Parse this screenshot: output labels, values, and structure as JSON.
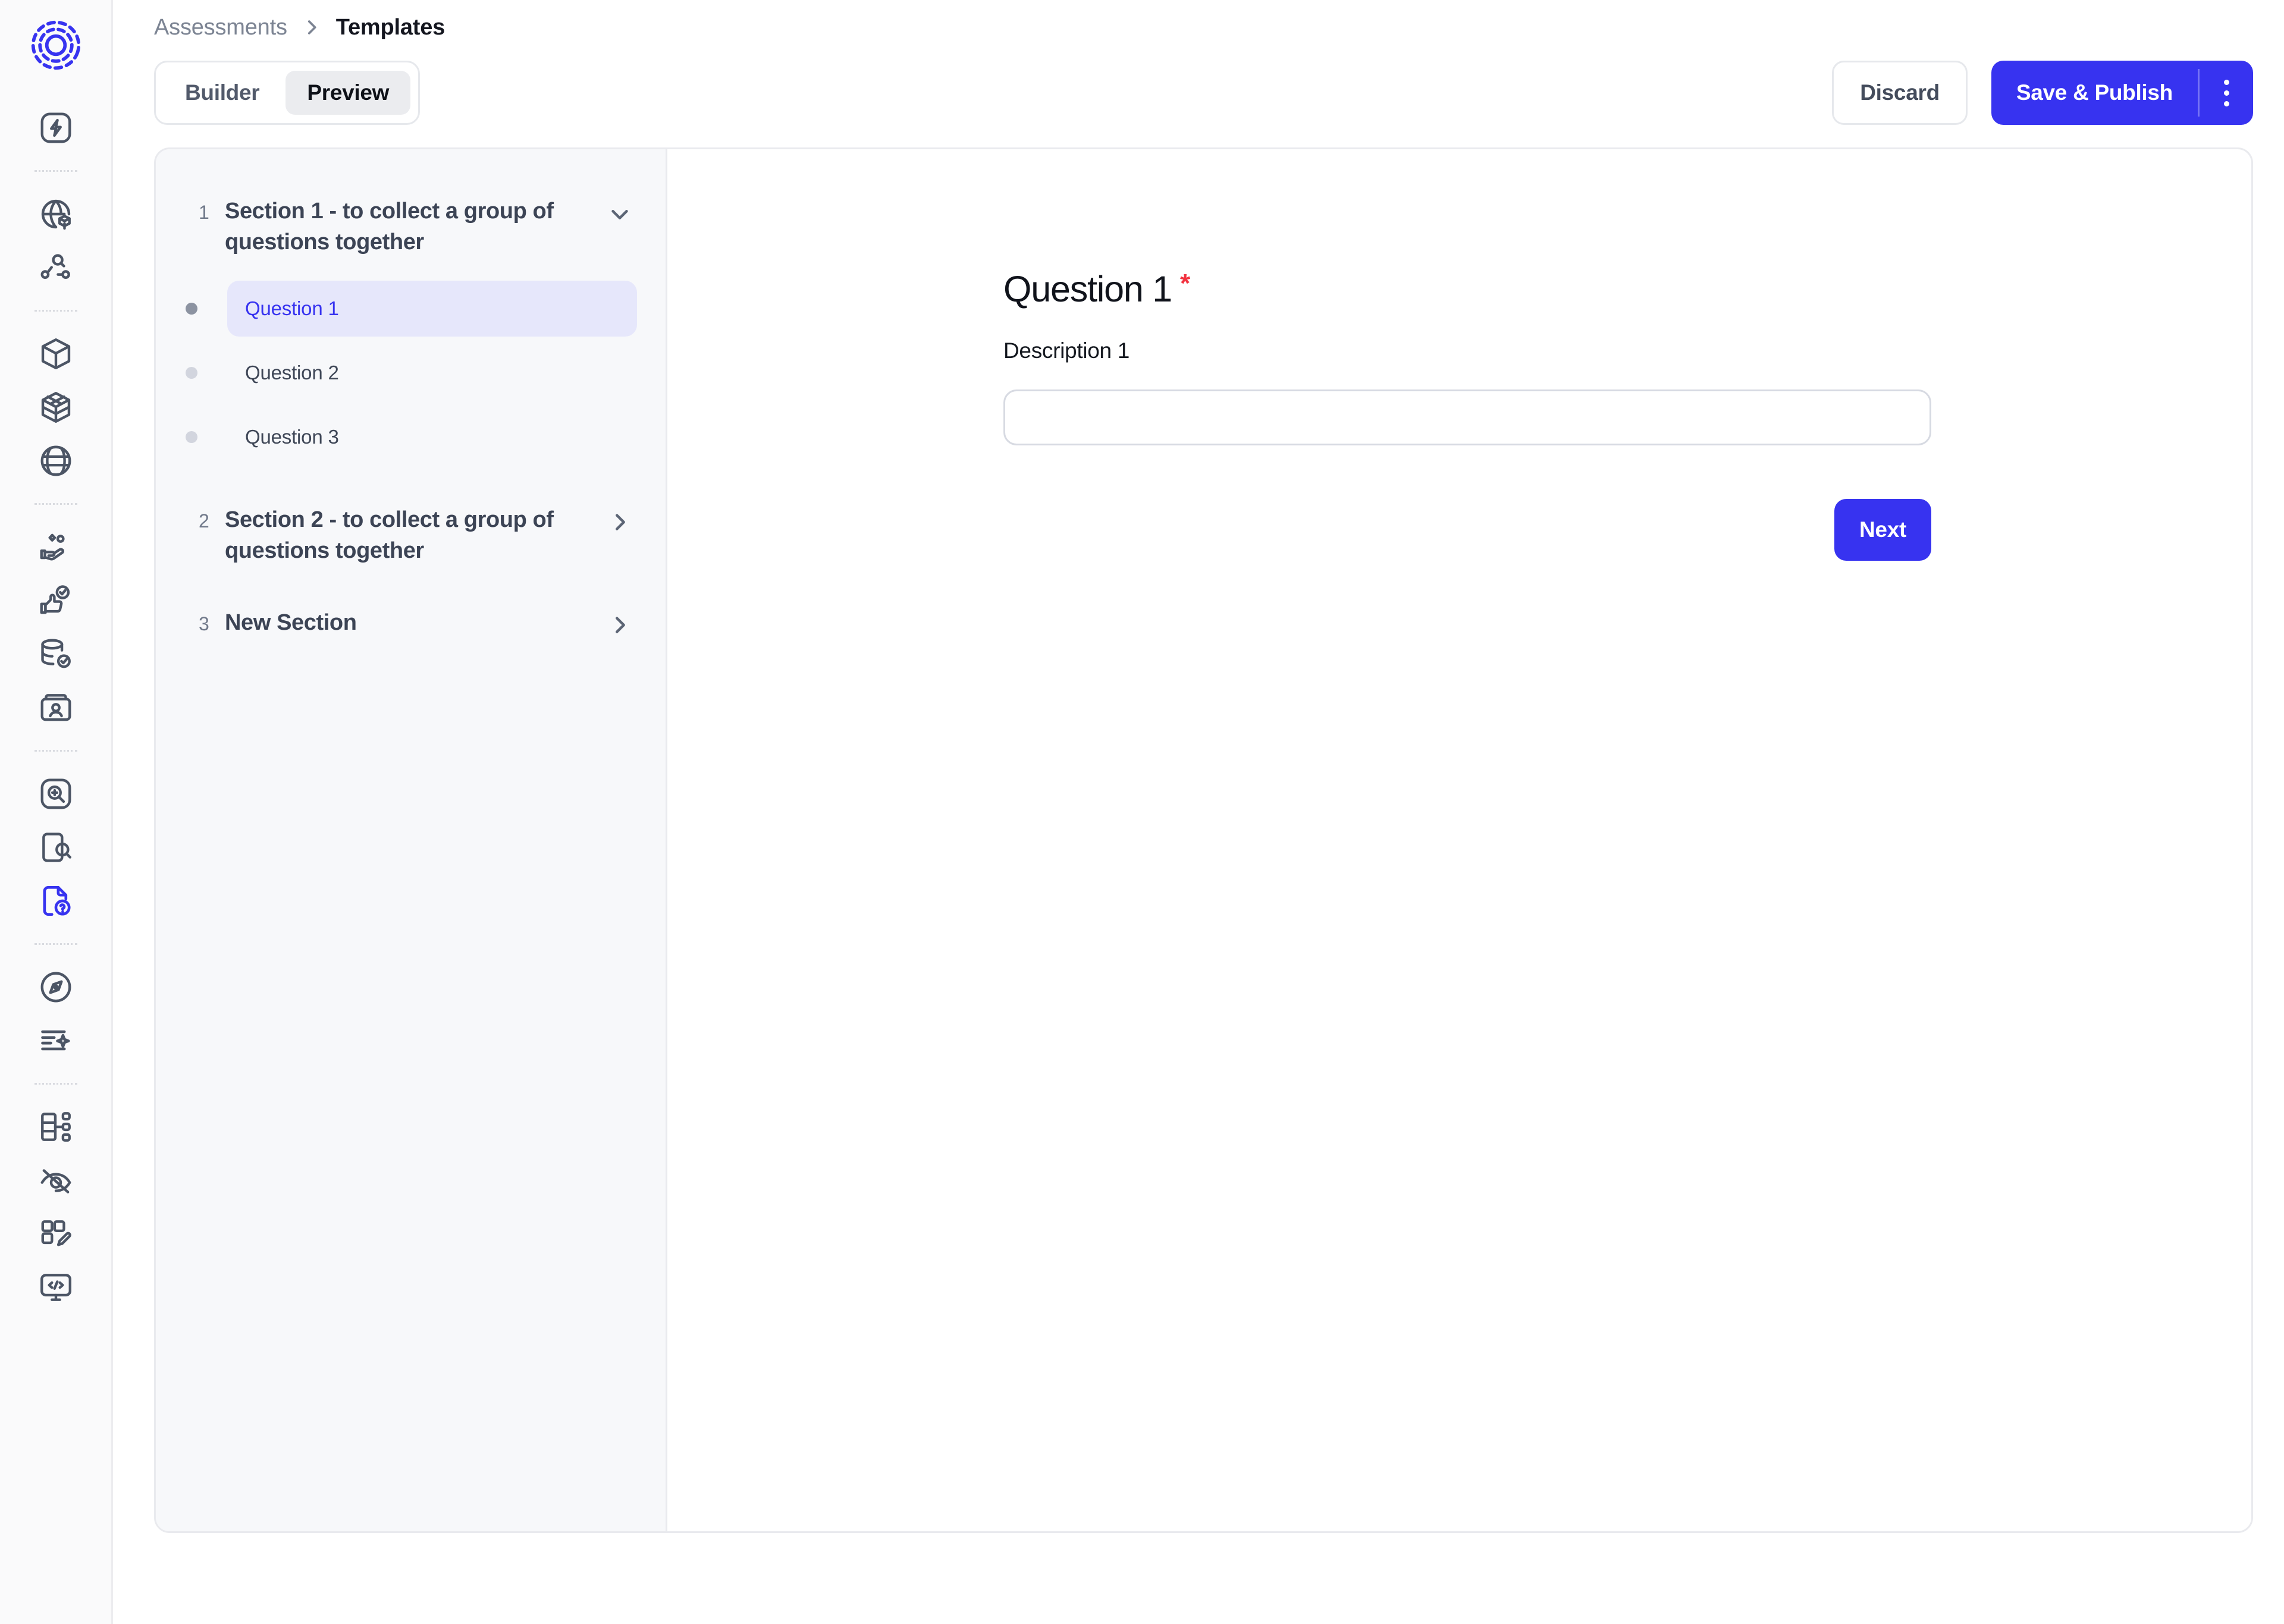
{
  "brand": {
    "accent": "#3733f0",
    "accent_soft": "#e6e7fb",
    "required_red": "#f2323f",
    "logo_name": "app-logo-radial-circle"
  },
  "rail": {
    "groups": [
      {
        "items": [
          {
            "icon": "lightning-bolt-square-icon",
            "active": false
          }
        ]
      },
      {
        "items": [
          {
            "icon": "globe-cube-icon",
            "active": false
          },
          {
            "icon": "network-search-nodes-icon",
            "active": false
          }
        ]
      },
      {
        "items": [
          {
            "icon": "cube-icon",
            "active": false
          },
          {
            "icon": "cube-grid-icon",
            "active": false
          },
          {
            "icon": "globe-sphere-icon",
            "active": false
          }
        ]
      },
      {
        "items": [
          {
            "icon": "hand-coins-icon",
            "active": false
          },
          {
            "icon": "thumbs-up-check-icon",
            "active": false
          },
          {
            "icon": "database-check-icon",
            "active": false
          },
          {
            "icon": "contact-card-icon",
            "active": false
          }
        ]
      },
      {
        "items": [
          {
            "icon": "magnifier-plus-square-icon",
            "active": false
          },
          {
            "icon": "document-search-icon",
            "active": false
          },
          {
            "icon": "document-question-icon",
            "active": true
          }
        ]
      },
      {
        "items": [
          {
            "icon": "compass-icon",
            "active": false
          },
          {
            "icon": "text-sparkle-icon",
            "active": false
          }
        ]
      },
      {
        "items": [
          {
            "icon": "table-tree-icon",
            "active": false
          },
          {
            "icon": "eye-off-icon",
            "active": false
          },
          {
            "icon": "layout-edit-icon",
            "active": false
          },
          {
            "icon": "code-monitor-icon",
            "active": false
          }
        ]
      }
    ]
  },
  "breadcrumb": {
    "parent": "Assessments",
    "separator_icon": "chevron-right-icon",
    "current": "Templates"
  },
  "toolbar": {
    "tabs": [
      {
        "label": "Builder",
        "active": false
      },
      {
        "label": "Preview",
        "active": true
      }
    ],
    "discard_label": "Discard",
    "save_label": "Save & Publish",
    "kebab_icon": "more-vertical-icon"
  },
  "sections": [
    {
      "number": "1",
      "title": "Section 1 - to collect a group of questions together",
      "expanded": true,
      "chevron": "chevron-down-icon",
      "questions": [
        {
          "label": "Question 1",
          "active": true
        },
        {
          "label": "Question 2",
          "active": false
        },
        {
          "label": "Question 3",
          "active": false
        }
      ]
    },
    {
      "number": "2",
      "title": "Section 2 - to collect a group of questions together",
      "expanded": false,
      "chevron": "chevron-right-icon",
      "questions": []
    },
    {
      "number": "3",
      "title": "New Section",
      "expanded": false,
      "chevron": "chevron-right-icon",
      "questions": []
    }
  ],
  "preview": {
    "question_title": "Question 1",
    "required_marker": "*",
    "description_label": "Description 1",
    "answer_value": "",
    "answer_placeholder": "",
    "next_label": "Next"
  }
}
